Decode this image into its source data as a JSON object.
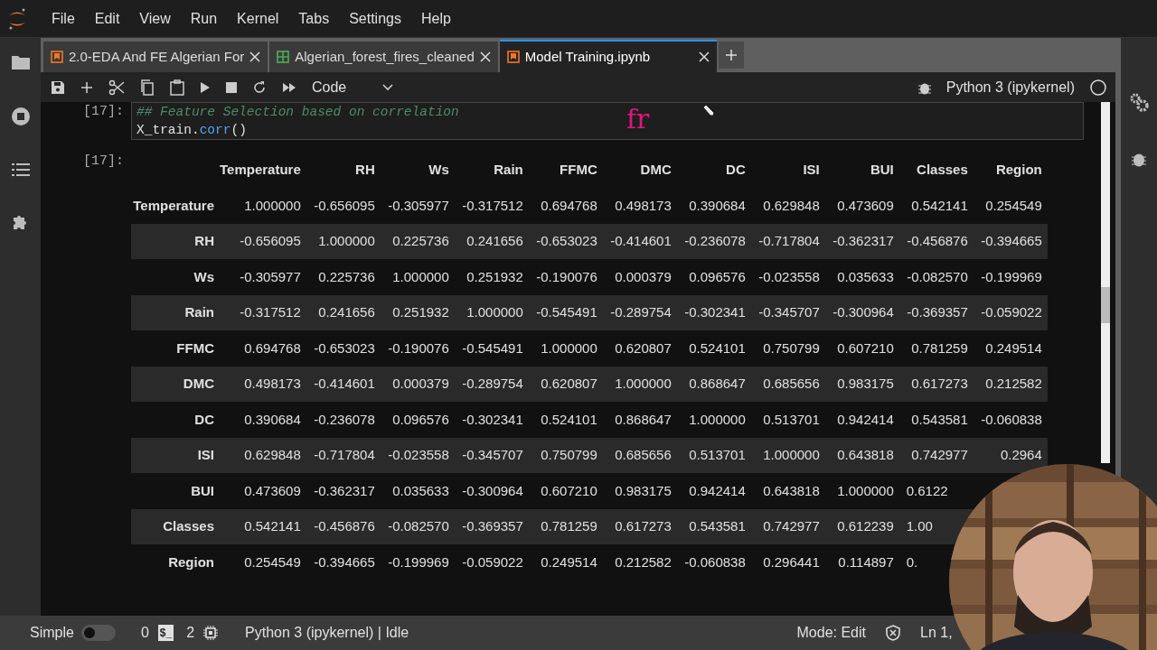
{
  "menu": [
    "File",
    "Edit",
    "View",
    "Run",
    "Kernel",
    "Tabs",
    "Settings",
    "Help"
  ],
  "tabs": [
    {
      "label": "2.0-EDA And FE Algerian For",
      "kind": "notebook",
      "selected": false
    },
    {
      "label": "Algerian_forest_fires_cleaned",
      "kind": "csv",
      "selected": false
    },
    {
      "label": "Model Training.ipynb",
      "kind": "notebook",
      "selected": true
    }
  ],
  "toolbar": {
    "cell_type": "Code",
    "kernel": "Python 3 (ipykernel)"
  },
  "cell": {
    "prompt": "[17]:",
    "comment": "## Feature Selection based on correlation",
    "code": [
      {
        "text": "X_train.",
        "kind": "name"
      },
      {
        "text": "corr",
        "kind": "func"
      },
      {
        "text": "()",
        "kind": "name"
      }
    ]
  },
  "annotation": "fr",
  "output": {
    "prompt": "[17]:",
    "table": {
      "columns": [
        "Temperature",
        "RH",
        "Ws",
        "Rain",
        "FFMC",
        "DMC",
        "DC",
        "ISI",
        "BUI",
        "Classes",
        "Region"
      ],
      "rows": [
        {
          "label": "Temperature",
          "cells": [
            "1.000000",
            "-0.656095",
            "-0.305977",
            "-0.317512",
            "0.694768",
            "0.498173",
            "0.390684",
            "0.629848",
            "0.473609",
            "0.542141",
            "0.254549"
          ]
        },
        {
          "label": "RH",
          "cells": [
            "-0.656095",
            "1.000000",
            "0.225736",
            "0.241656",
            "-0.653023",
            "-0.414601",
            "-0.236078",
            "-0.717804",
            "-0.362317",
            "-0.456876",
            "-0.394665"
          ]
        },
        {
          "label": "Ws",
          "cells": [
            "-0.305977",
            "0.225736",
            "1.000000",
            "0.251932",
            "-0.190076",
            "0.000379",
            "0.096576",
            "-0.023558",
            "0.035633",
            "-0.082570",
            "-0.199969"
          ]
        },
        {
          "label": "Rain",
          "cells": [
            "-0.317512",
            "0.241656",
            "0.251932",
            "1.000000",
            "-0.545491",
            "-0.289754",
            "-0.302341",
            "-0.345707",
            "-0.300964",
            "-0.369357",
            "-0.059022"
          ]
        },
        {
          "label": "FFMC",
          "cells": [
            "0.694768",
            "-0.653023",
            "-0.190076",
            "-0.545491",
            "1.000000",
            "0.620807",
            "0.524101",
            "0.750799",
            "0.607210",
            "0.781259",
            "0.249514"
          ]
        },
        {
          "label": "DMC",
          "cells": [
            "0.498173",
            "-0.414601",
            "0.000379",
            "-0.289754",
            "0.620807",
            "1.000000",
            "0.868647",
            "0.685656",
            "0.983175",
            "0.617273",
            "0.212582"
          ]
        },
        {
          "label": "DC",
          "cells": [
            "0.390684",
            "-0.236078",
            "0.096576",
            "-0.302341",
            "0.524101",
            "0.868647",
            "1.000000",
            "0.513701",
            "0.942414",
            "0.543581",
            "-0.060838"
          ]
        },
        {
          "label": "ISI",
          "cells": [
            "0.629848",
            "-0.717804",
            "-0.023558",
            "-0.345707",
            "0.750799",
            "0.685656",
            "0.513701",
            "1.000000",
            "0.643818",
            "0.742977",
            "0.2964"
          ]
        },
        {
          "label": "BUI",
          "cells": [
            "0.473609",
            "-0.362317",
            "0.035633",
            "-0.300964",
            "0.607210",
            "0.983175",
            "0.942414",
            "0.643818",
            "1.000000",
            "0.6122"
          ]
        },
        {
          "label": "Classes",
          "cells": [
            "0.542141",
            "-0.456876",
            "-0.082570",
            "-0.369357",
            "0.781259",
            "0.617273",
            "0.543581",
            "0.742977",
            "0.612239",
            "1.00"
          ]
        },
        {
          "label": "Region",
          "cells": [
            "0.254549",
            "-0.394665",
            "-0.199969",
            "-0.059022",
            "0.249514",
            "0.212582",
            "-0.060838",
            "0.296441",
            "0.114897",
            "0."
          ]
        }
      ]
    }
  },
  "status_bar": {
    "mode_label": "Simple",
    "simple_on": false,
    "terminals": "0",
    "terminal_badge": "$_",
    "kernels": "2",
    "kernel_status": "Python 3 (ipykernel) | Idle",
    "mode": "Mode: Edit",
    "position": "Ln 1,"
  }
}
